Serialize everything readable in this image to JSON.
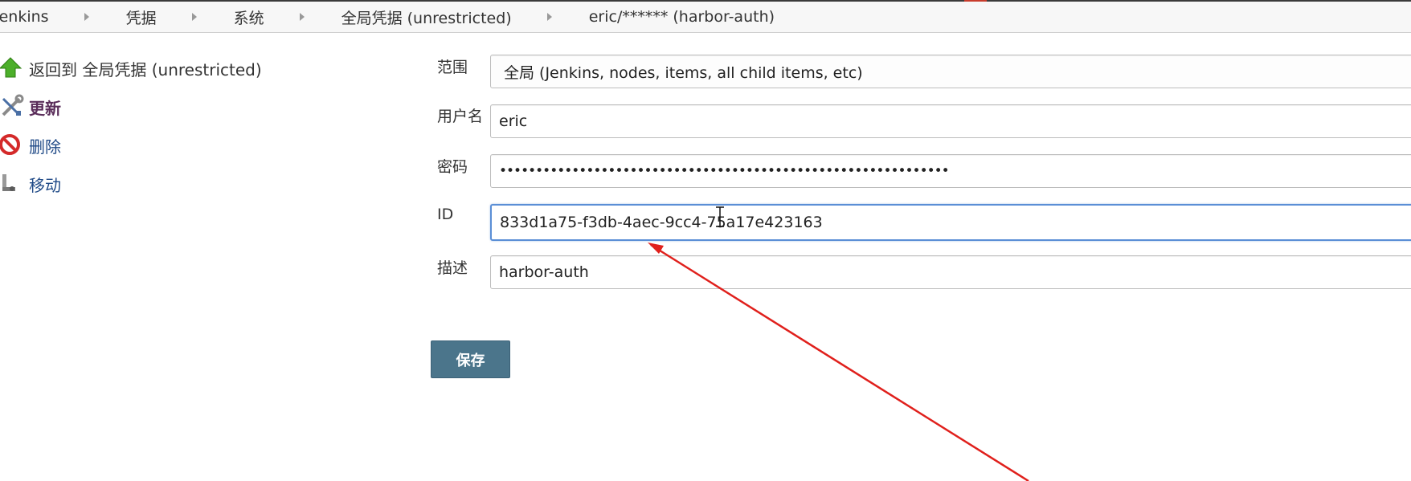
{
  "breadcrumb": {
    "items": [
      "Jenkins",
      "凭据",
      "系统",
      "全局凭据 (unrestricted)",
      "eric/****** (harbor-auth)"
    ]
  },
  "sidebar": {
    "items": [
      {
        "label": "返回到 全局凭据 (unrestricted)",
        "icon": "up-arrow-icon"
      },
      {
        "label": "更新",
        "icon": "wrench-screwdriver-icon"
      },
      {
        "label": "删除",
        "icon": "no-entry-icon"
      },
      {
        "label": "移动",
        "icon": "move-icon"
      }
    ]
  },
  "form": {
    "scope": {
      "label": "范围",
      "value": "全局 (Jenkins, nodes, items, all child items, etc)"
    },
    "username": {
      "label": "用户名",
      "value": "eric"
    },
    "password": {
      "label": "密码",
      "value": "••••••••••••••••••••••••••••••••••••••••••••••••••••••••••••••"
    },
    "id": {
      "label": "ID",
      "value": "833d1a75-f3db-4aec-9cc4-75a17e423163"
    },
    "description": {
      "label": "描述",
      "value": "harbor-auth"
    },
    "save_label": "保存"
  },
  "colors": {
    "annotation_arrow": "#e0201c",
    "save_button": "#4b758b",
    "focus_border": "#5b8fd6"
  }
}
